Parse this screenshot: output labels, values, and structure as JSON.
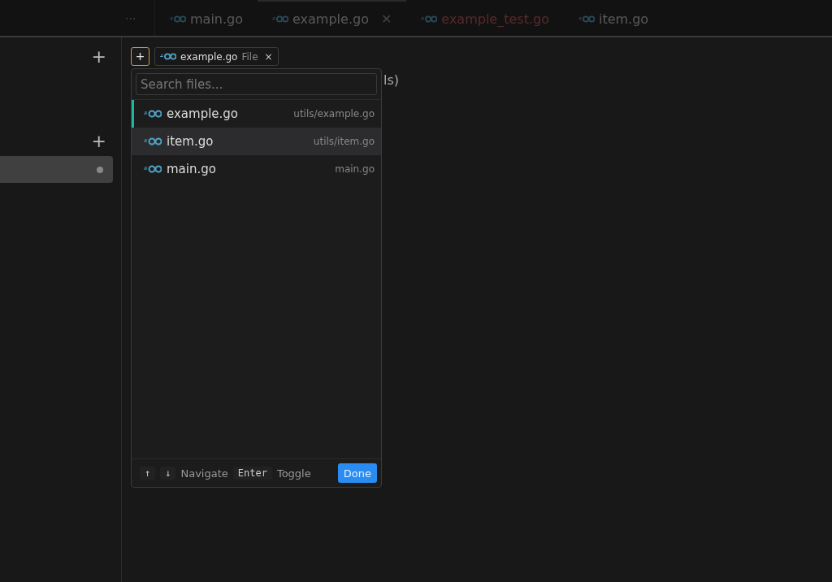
{
  "tabs_overflow": "⋯",
  "tabs": [
    {
      "label": "main.go",
      "selected": false,
      "color": "#5a5a5a"
    },
    {
      "label": "example.go",
      "selected": true,
      "color": "#5a5a5a",
      "close": "✕"
    },
    {
      "label": "example_test.go",
      "selected": false,
      "color": "#5a2a2a"
    },
    {
      "label": "item.go",
      "selected": false,
      "color": "#5a5a5a"
    }
  ],
  "sidebar": {
    "sections": [
      {
        "add": "+"
      },
      {
        "add": "+",
        "items": [
          {
            "selected": true,
            "dot": true
          }
        ]
      }
    ]
  },
  "context": {
    "add": "+",
    "chips": [
      {
        "label": "example.go",
        "type": "File",
        "remove": "×"
      }
    ],
    "behind_text": "ls)"
  },
  "picker": {
    "search": {
      "placeholder": "Search files..."
    },
    "files": [
      {
        "name": "example.go",
        "path": "utils/example.go",
        "selected": true,
        "highlighted": false
      },
      {
        "name": "item.go",
        "path": "utils/item.go",
        "selected": false,
        "highlighted": true
      },
      {
        "name": "main.go",
        "path": "main.go",
        "selected": false,
        "highlighted": false
      }
    ],
    "hints": [
      {
        "keys": [
          "↑",
          "↓"
        ],
        "label": "Navigate"
      },
      {
        "keys": [
          "Enter"
        ],
        "label": "Toggle"
      }
    ],
    "done": "Done"
  }
}
